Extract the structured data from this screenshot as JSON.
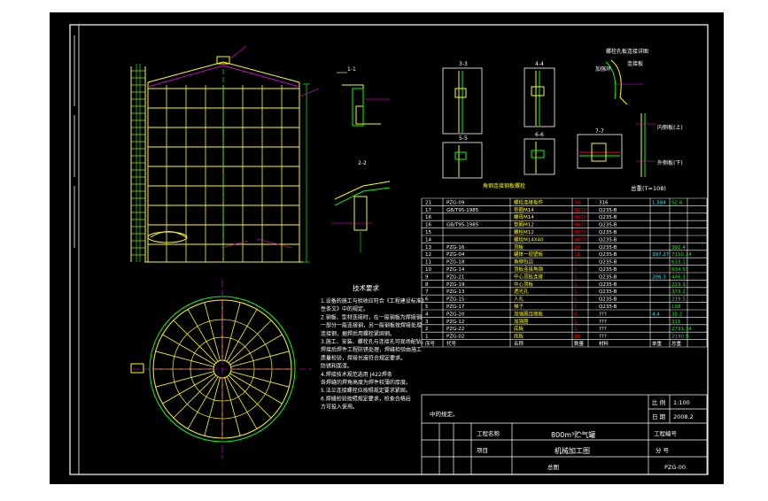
{
  "colors": {
    "background": "#000000",
    "frame": "#ffffff",
    "tank": "#ffff00",
    "dim": "#00ff00",
    "accent": "#ff00ff",
    "note": "#ffffff",
    "table_red": "#ff0000",
    "table_cyan": "#00ffff",
    "table_green": "#00ff00"
  },
  "notes": {
    "title": "技术要求",
    "lines": [
      "1.设备的施工与验收应符合《工程建设标准》",
      "  性条文》中的规定。",
      "2.钢板、型材连接时，在一般钢板为焊接钢",
      "  一部分一般连接钢，另一般钢板按焊接处理",
      "  连接钢，据焊后用螺栓紧固钢。",
      "3.施工、安装、螺栓孔与连接孔可现场配钻，",
      "  焊接后焊件工程防锈处理，焊缝检验由施工",
      "  质量检验，焊接长度符合规定要求。",
      "  防锈和面漆。",
      "4.焊接技术规范选用 J422焊条",
      "  各焊缝的焊角高度为焊件较薄的厚度。",
      "5.法兰连接螺栓应按照规定要求紧固。",
      "6.焊缝检验按照规定要求，检查合格后",
      "  方可投入使用。"
    ],
    "note_end": "中的规定。"
  },
  "sections": {
    "s1": "1-1",
    "s2": "2-2",
    "s3": "3-3",
    "s4": "4-4",
    "s5": "5-5",
    "s6": "6-6",
    "s7": "7-7",
    "detail_title": "螺栓孔板连接详图",
    "detail_a": "加强环",
    "detail_b": "连接板",
    "detail_c": "内侧板(上)",
    "detail_d": "外侧板(下)",
    "label_bottom": "角钢连接钢板螺栓"
  },
  "bom": {
    "header": "总重(T=108)",
    "rows": [
      {
        "no": "21",
        "code": "PZG-09",
        "name": "螺栓连接板件",
        "qty": "30",
        "mat": "316",
        "w1": "1.584",
        "w2": "52.6"
      },
      {
        "no": "17",
        "code": "GB/T95-1985",
        "name": "垫圈M14",
        "qty": "9600",
        "mat": "Q235-B",
        "w1": "",
        "w2": ""
      },
      {
        "no": "16",
        "code": "",
        "name": "螺母M14",
        "qty": "9600",
        "mat": "Q235-B",
        "w1": "",
        "w2": ""
      },
      {
        "no": "16",
        "code": "GB/T95-1985",
        "name": "垫圈M12",
        "qty": "9600",
        "mat": "Q235-B",
        "w1": "",
        "w2": ""
      },
      {
        "no": "15",
        "code": "",
        "name": "螺栓M12",
        "qty": "9600",
        "mat": "Q235-B",
        "w1": "",
        "w2": ""
      },
      {
        "no": "14",
        "code": "",
        "name": "螺栓M14X40",
        "qty": "9600",
        "mat": "Q235-B",
        "w1": "",
        "w2": ""
      },
      {
        "no": "13",
        "code": "PZG-16",
        "name": "顶板",
        "qty": "20",
        "mat": "Q235-B",
        "w1": "",
        "w2": "392.4"
      },
      {
        "no": "12",
        "code": "PZG-04",
        "name": "罐体一层壁板",
        "qty": "18",
        "mat": "Q235-B",
        "w1": "397.27",
        "w2": "7150.14"
      },
      {
        "no": "11",
        "code": "PZG-18",
        "name": "角钢包边",
        "qty": "1",
        "mat": "Q235-B",
        "w1": "",
        "w2": "633.11"
      },
      {
        "no": "10",
        "code": "PZG-14",
        "name": "顶板连接角钢",
        "qty": "1",
        "mat": "Q235-B",
        "w1": "",
        "w2": "634.51"
      },
      {
        "no": "9",
        "code": "PZG-21",
        "name": "中心顶板连接",
        "qty": "1",
        "mat": "Q235-B",
        "w1": "206.3",
        "w2": "446.3"
      },
      {
        "no": "8",
        "code": "PZG-19",
        "name": "中心顶板",
        "qty": "1",
        "mat": "Q235-B",
        "w1": "",
        "w2": "219.3"
      },
      {
        "no": "7",
        "code": "PZG-13",
        "name": "透光孔",
        "qty": "1",
        "mat": "Q235-B",
        "w1": "",
        "w2": "373.2"
      },
      {
        "no": "6",
        "code": "PZG-15",
        "name": "人孔",
        "qty": "1",
        "mat": "Q235-B",
        "w1": "",
        "w2": "219.5"
      },
      {
        "no": "5",
        "code": "PZG-17",
        "name": "梯子",
        "qty": "1",
        "mat": "Q235-B",
        "w1": "",
        "w2": "108"
      },
      {
        "no": "4",
        "code": "PZG-20",
        "name": "加强圈连接板",
        "qty": "8",
        "mat": "???",
        "w1": "4.4",
        "w2": "35.2"
      },
      {
        "no": "3",
        "code": "PZG-12",
        "name": "加强圈",
        "qty": "1",
        "mat": "???",
        "w1": "",
        "w2": "315"
      },
      {
        "no": "2",
        "code": "PZG-22",
        "name": "底板",
        "qty": "1",
        "mat": "???",
        "w1": "",
        "w2": "2791.34"
      },
      {
        "no": "1",
        "code": "PZG-02",
        "name": "底板",
        "qty": "80",
        "mat": "???",
        "w1": "",
        "w2": "2190.9"
      }
    ],
    "footer": [
      "序号",
      "代号",
      "名称",
      "数量",
      "材料",
      "单重",
      "总重"
    ]
  },
  "title_block": {
    "project_label": "工程名称",
    "project_value": "800m³贮气罐",
    "item_label": "项目",
    "item_value": "机械加工图",
    "drawing_label": "总图",
    "scale_a": "比 例",
    "scale_a_val": "1:100",
    "scale_b": "日 期",
    "scale_b_val": "2008.2",
    "job_label": "工程编号",
    "sheet_label": "分 号",
    "drawing_no": "PZG-00"
  }
}
